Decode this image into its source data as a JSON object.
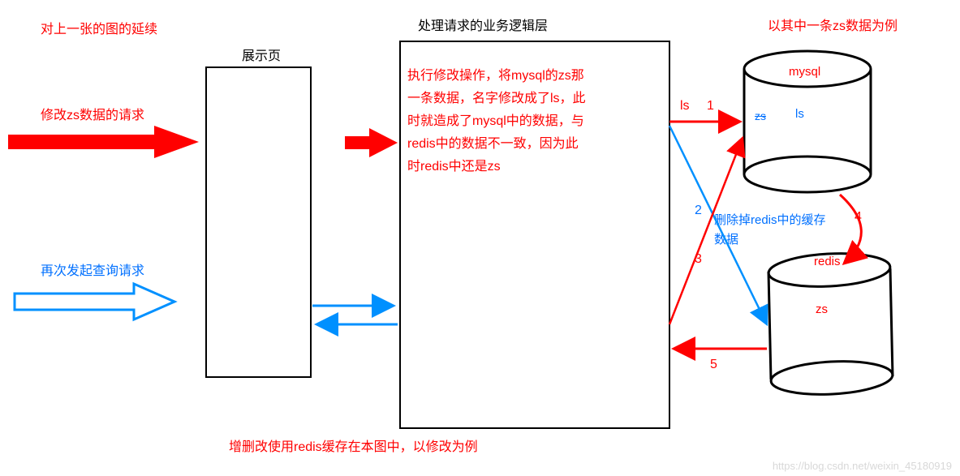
{
  "labels": {
    "continuation": "对上一张的图的延续",
    "display_page": "展示页",
    "logic_layer": "处理请求的业务逻辑层",
    "example_note": "以其中一条zs数据为例",
    "modify_request": "修改zs数据的请求",
    "query_again": "再次发起查询请求",
    "logic_text_l1": "执行修改操作，将mysql的zs那",
    "logic_text_l2": "一条数据，名字修改成了ls，此",
    "logic_text_l3": "时就造成了mysql中的数据，与",
    "logic_text_l4": "redis中的数据不一致，因为此",
    "logic_text_l5": "时redis中还是zs",
    "ls": "ls",
    "num1": "1",
    "num2": "2",
    "num3": "3",
    "num4": "4",
    "num5": "5",
    "delete_cache_l1": "删除掉redis中的缓存",
    "delete_cache_l2": "数据",
    "mysql": "mysql",
    "redis": "redis",
    "mysql_zs": "zs",
    "mysql_ls": "ls",
    "redis_zs": "zs",
    "bottom_note": "增删改使用redis缓存在本图中，以修改为例",
    "watermark": "https://blog.csdn.net/weixin_45180919"
  },
  "chart_data": {
    "type": "diagram",
    "title": "增删改使用redis缓存在本图中，以修改为例",
    "nodes": [
      {
        "id": "display",
        "label": "展示页",
        "type": "box"
      },
      {
        "id": "logic",
        "label": "处理请求的业务逻辑层",
        "type": "box",
        "content": "执行修改操作，将mysql的zs那一条数据，名字修改成了ls，此时就造成了mysql中的数据，与redis中的数据不一致，因为此时redis中还是zs"
      },
      {
        "id": "mysql",
        "label": "mysql",
        "type": "cylinder",
        "data": [
          "zs",
          "ls"
        ]
      },
      {
        "id": "redis",
        "label": "redis",
        "type": "cylinder",
        "data": [
          "zs"
        ]
      }
    ],
    "edges": [
      {
        "from": "external",
        "to": "display",
        "label": "修改zs数据的请求",
        "color": "red"
      },
      {
        "from": "external",
        "to": "display",
        "label": "再次发起查询请求",
        "color": "blue"
      },
      {
        "from": "display",
        "to": "logic",
        "color": "red"
      },
      {
        "from": "display",
        "to": "logic",
        "color": "blue",
        "bidirectional": true
      },
      {
        "from": "logic",
        "to": "mysql",
        "label": "ls 1",
        "color": "red"
      },
      {
        "from": "logic",
        "to": "redis",
        "label": "2",
        "color": "blue"
      },
      {
        "from": "logic",
        "to": "mysql",
        "label": "3",
        "color": "red"
      },
      {
        "from": "mysql",
        "to": "redis",
        "label": "4 删除掉redis中的缓存数据",
        "color": "red"
      },
      {
        "from": "redis",
        "to": "logic",
        "label": "5",
        "color": "red"
      }
    ],
    "annotations": [
      "对上一张的图的延续",
      "以其中一条zs数据为例"
    ]
  }
}
